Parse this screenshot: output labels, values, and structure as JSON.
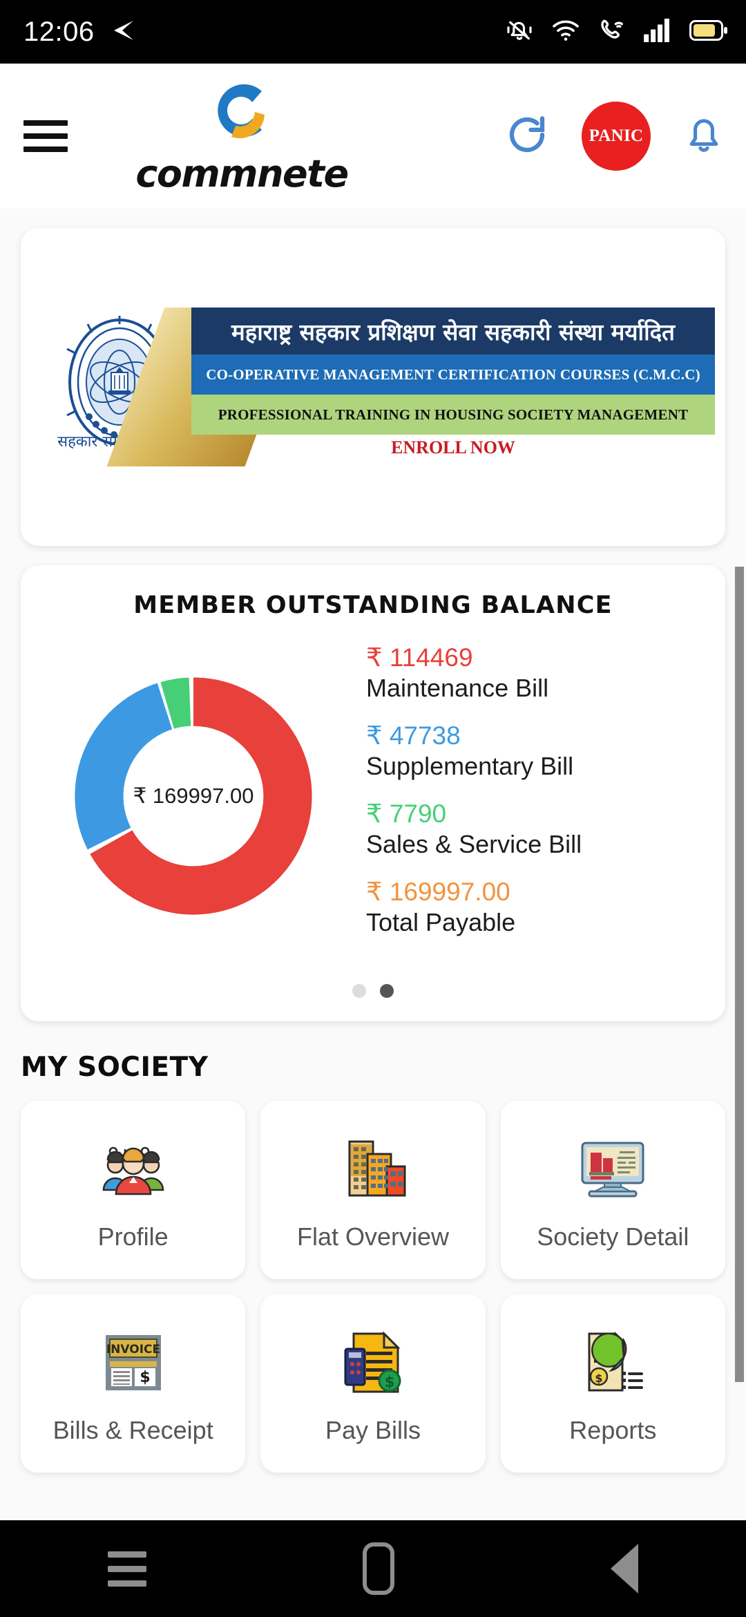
{
  "statusbar": {
    "time": "12:06",
    "icons": [
      "send-arrow-icon",
      "vibrate-off-icon",
      "wifi-icon",
      "vowifi-call-icon",
      "signal-bars-icon",
      "battery-icon"
    ],
    "battery_color": "#f6dd7e"
  },
  "header": {
    "menu_icon": "hamburger-menu-icon",
    "brand_name": "commnete",
    "brand_colors": {
      "blue": "#2079c4",
      "orange": "#f0a81e"
    },
    "refresh_label": "refresh-icon",
    "panic_label": "PANIC",
    "panic_color": "#e8201f",
    "bell_label": "notification-bell-icon",
    "accent_blue": "#4a86d0"
  },
  "banner": {
    "crest_tagline": "सहकार समृद्धि व ज्ञान!",
    "line1": "महाराष्ट्र सहकार प्रशिक्षण सेवा सहकारी संस्था मर्यादित",
    "line2": "CO-OPERATIVE MANAGEMENT CERTIFICATION COURSES (C.M.C.C)",
    "line3": "PROFESSIONAL TRAINING IN HOUSING SOCIETY MANAGEMENT",
    "cta": "ENROLL NOW",
    "colors": {
      "navy": "#1b3a66",
      "blue": "#1e6cb5",
      "green": "#aed47e",
      "cta": "#c71c22"
    }
  },
  "balance": {
    "title": "MEMBER OUTSTANDING BALANCE",
    "center_total": "₹ 169997.00",
    "items": [
      {
        "amount": "₹ 114469",
        "label": "Maintenance Bill",
        "color": "#e8403a"
      },
      {
        "amount": "₹ 47738",
        "label": "Supplementary Bill",
        "color": "#3d9ae2"
      },
      {
        "amount": "₹ 7790",
        "label": "Sales & Service Bill",
        "color": "#46cf77"
      },
      {
        "amount": "₹ 169997.00",
        "label": "Total Payable",
        "color": "#f0933d"
      }
    ],
    "pager": {
      "count": 2,
      "active_index": 1
    }
  },
  "chart_data": {
    "type": "pie",
    "title": "MEMBER OUTSTANDING BALANCE",
    "labels": [
      "Maintenance Bill",
      "Supplementary Bill",
      "Sales & Service Bill"
    ],
    "values": [
      114469,
      47738,
      7790
    ],
    "colors": [
      "#e8403a",
      "#3d9ae2",
      "#46cf77"
    ],
    "total": 169997.0,
    "center_label": "₹ 169997.00",
    "donut": true,
    "legend_position": "right",
    "currency": "₹"
  },
  "my_society": {
    "section_title": "MY SOCIETY",
    "tiles": [
      {
        "label": "Profile",
        "icon": "people-group-icon"
      },
      {
        "label": "Flat Overview",
        "icon": "buildings-icon"
      },
      {
        "label": "Society Detail",
        "icon": "desktop-monitor-icon"
      },
      {
        "label": "Bills & Receipt",
        "icon": "invoice-icon"
      },
      {
        "label": "Pay Bills",
        "icon": "pay-document-calculator-icon"
      },
      {
        "label": "Reports",
        "icon": "report-piechart-icon"
      }
    ]
  },
  "navbar": {
    "recents": "recents-icon",
    "home": "home-icon",
    "back": "back-icon"
  }
}
